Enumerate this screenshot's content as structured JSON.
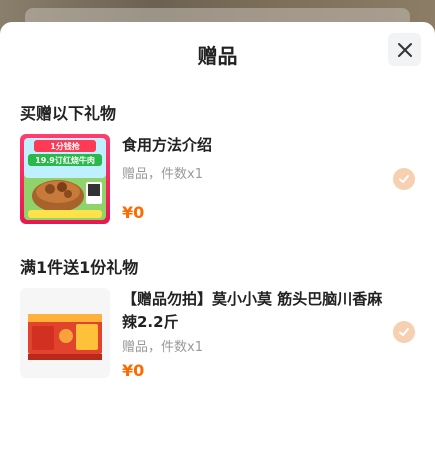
{
  "title": "赠品",
  "sections": [
    {
      "title": "买赠以下礼物",
      "item": {
        "name": "食用方法介绍",
        "meta": "赠品，件数x1",
        "price": "¥0",
        "thumb": {
          "line1": "1分钱抢",
          "line2": "19.9订红烧牛肉"
        }
      }
    },
    {
      "title": "满1件送1份礼物",
      "item": {
        "name": "【赠品勿拍】莫小小莫 筋头巴脑川香麻辣2.2斤",
        "meta": "赠品，件数x1",
        "price": "¥0"
      }
    }
  ],
  "colors": {
    "price": "#ff6a00",
    "check": "#f7cfb1",
    "close_bg": "#f2f3f5"
  },
  "icons": {
    "close": "close-icon",
    "check": "check-icon"
  }
}
